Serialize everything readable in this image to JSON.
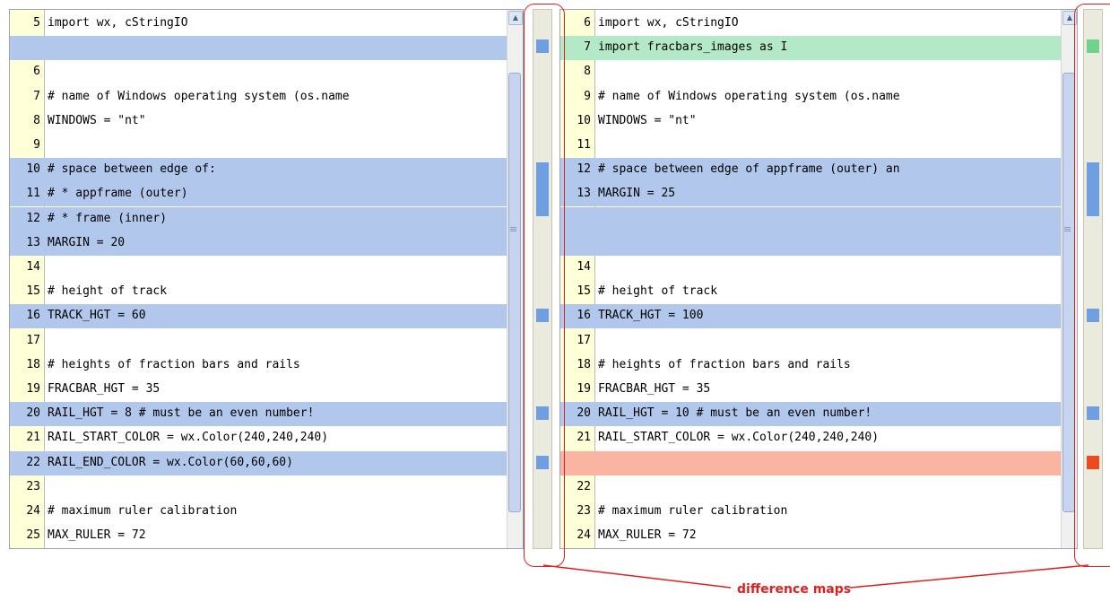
{
  "left_pane": {
    "lines": [
      {
        "num": "5",
        "code": "import wx, cStringIO",
        "status": "same"
      },
      {
        "num": "",
        "code": "",
        "status": "changed"
      },
      {
        "num": "6",
        "code": "",
        "status": "same"
      },
      {
        "num": "7",
        "code": "# name of Windows operating system (os.name",
        "status": "same"
      },
      {
        "num": "8",
        "code": "WINDOWS = \"nt\"",
        "status": "same"
      },
      {
        "num": "9",
        "code": "",
        "status": "same"
      },
      {
        "num": "10",
        "code": "# space between edge of:",
        "status": "changed"
      },
      {
        "num": "11",
        "code": "# * appframe (outer)",
        "status": "changed"
      },
      {
        "num": "12",
        "code": "# * frame (inner)",
        "status": "changed"
      },
      {
        "num": "13",
        "code": "MARGIN = 20",
        "status": "changed"
      },
      {
        "num": "14",
        "code": "",
        "status": "same"
      },
      {
        "num": "15",
        "code": "# height of track",
        "status": "same"
      },
      {
        "num": "16",
        "code": "TRACK_HGT = 60",
        "status": "changed"
      },
      {
        "num": "17",
        "code": "",
        "status": "same"
      },
      {
        "num": "18",
        "code": "# heights of fraction bars and rails",
        "status": "same"
      },
      {
        "num": "19",
        "code": "FRACBAR_HGT = 35",
        "status": "same"
      },
      {
        "num": "20",
        "code": "RAIL_HGT = 8 # must be an even number!",
        "status": "changed"
      },
      {
        "num": "21",
        "code": "RAIL_START_COLOR = wx.Color(240,240,240)",
        "status": "same"
      },
      {
        "num": "22",
        "code": "RAIL_END_COLOR = wx.Color(60,60,60)",
        "status": "changed"
      },
      {
        "num": "23",
        "code": "",
        "status": "same"
      },
      {
        "num": "24",
        "code": "# maximum ruler calibration",
        "status": "same"
      },
      {
        "num": "25",
        "code": "MAX_RULER = 72",
        "status": "same"
      }
    ]
  },
  "right_pane": {
    "lines": [
      {
        "num": "6",
        "code": "import wx, cStringIO",
        "status": "same"
      },
      {
        "num": "7",
        "code": "import fracbars_images as I",
        "status": "added"
      },
      {
        "num": "8",
        "code": "",
        "status": "same"
      },
      {
        "num": "9",
        "code": "# name of Windows operating system (os.name",
        "status": "same"
      },
      {
        "num": "10",
        "code": "WINDOWS = \"nt\"",
        "status": "same"
      },
      {
        "num": "11",
        "code": "",
        "status": "same"
      },
      {
        "num": "12",
        "code": "# space between edge of appframe (outer) an",
        "status": "changed"
      },
      {
        "num": "13",
        "code": "MARGIN = 25",
        "status": "changed"
      },
      {
        "num": "",
        "code": "",
        "status": "changed"
      },
      {
        "num": "",
        "code": "",
        "status": "changed"
      },
      {
        "num": "14",
        "code": "",
        "status": "same"
      },
      {
        "num": "15",
        "code": "# height of track",
        "status": "same"
      },
      {
        "num": "16",
        "code": "TRACK_HGT = 100",
        "status": "changed"
      },
      {
        "num": "17",
        "code": "",
        "status": "same"
      },
      {
        "num": "18",
        "code": "# heights of fraction bars and rails",
        "status": "same"
      },
      {
        "num": "19",
        "code": "FRACBAR_HGT = 35",
        "status": "same"
      },
      {
        "num": "20",
        "code": "RAIL_HGT = 10 # must be an even number!",
        "status": "changed"
      },
      {
        "num": "21",
        "code": "RAIL_START_COLOR = wx.Color(240,240,240)",
        "status": "same"
      },
      {
        "num": "",
        "code": "",
        "status": "removed"
      },
      {
        "num": "22",
        "code": "",
        "status": "same"
      },
      {
        "num": "23",
        "code": "# maximum ruler calibration",
        "status": "same"
      },
      {
        "num": "24",
        "code": "MAX_RULER = 72",
        "status": "same"
      }
    ]
  },
  "annotation": {
    "label": "difference maps"
  },
  "colors": {
    "changed": "#b1c7ec",
    "added": "#b4e9c8",
    "removed": "#f9b4a2",
    "callout": "#e0201e"
  }
}
